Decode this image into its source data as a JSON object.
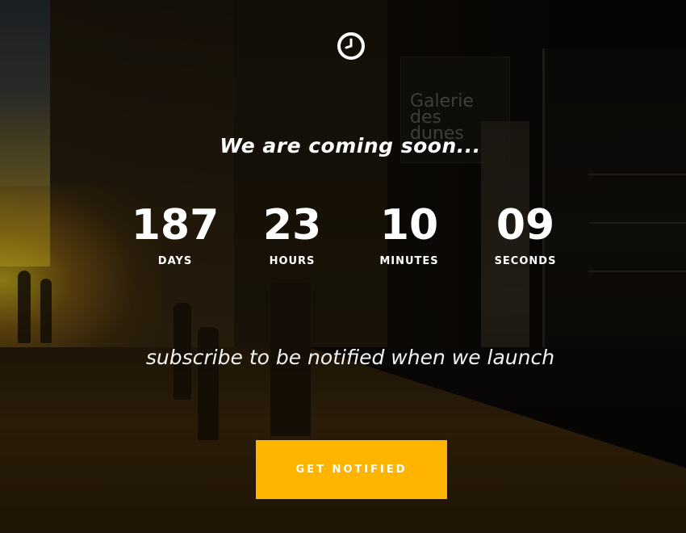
{
  "hero": {
    "icon": "clock-icon",
    "headline": "We are coming soon...",
    "subscribe_text": "subscribe to be notified when we launch"
  },
  "countdown": [
    {
      "value": "187",
      "label": "DAYS"
    },
    {
      "value": "23",
      "label": "HOURS"
    },
    {
      "value": "10",
      "label": "MINUTES"
    },
    {
      "value": "09",
      "label": "SECONDS"
    }
  ],
  "cta": {
    "label": "GET NOTIFIED",
    "color": "#ffb400"
  },
  "background": {
    "sign_text": "Galerie des dunes"
  }
}
